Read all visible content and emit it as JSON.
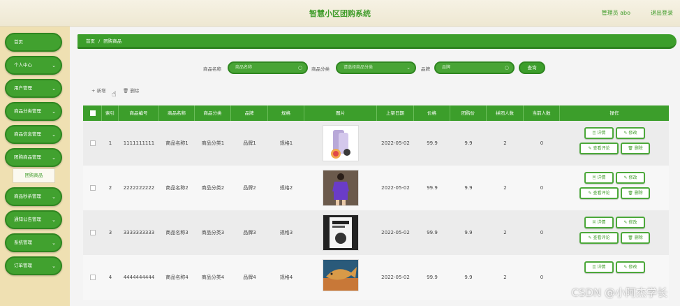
{
  "app": {
    "title": "智慧小区团购系统",
    "user": "管理员 abo",
    "logout": "退出登录"
  },
  "sidebar": {
    "items": [
      {
        "label": "首页",
        "chevron": false
      },
      {
        "label": "个人中心",
        "chevron": true
      },
      {
        "label": "用户管理",
        "chevron": true
      },
      {
        "label": "商品分类管理",
        "chevron": true
      },
      {
        "label": "商品信息管理",
        "chevron": true
      },
      {
        "label": "团购商品管理",
        "chevron": true
      },
      {
        "label": "商品秒杀管理",
        "chevron": true
      },
      {
        "label": "通知公告管理",
        "chevron": true
      },
      {
        "label": "系统管理",
        "chevron": true
      },
      {
        "label": "订单管理",
        "chevron": true
      }
    ],
    "sub_item": "团购商品"
  },
  "breadcrumb": {
    "home": "首页",
    "sep": "/",
    "current": "团购商品"
  },
  "search": {
    "name_label": "商品名称",
    "name_placeholder": "商品名称",
    "category_label": "商品分类",
    "category_placeholder": "请选择商品分类",
    "brand_label": "品牌",
    "brand_placeholder": "品牌",
    "query_button": "查询"
  },
  "toolbar": {
    "add": "+ 新增",
    "delete": "🗑 删除"
  },
  "table": {
    "headers": [
      "索引",
      "商品编号",
      "商品名称",
      "商品分类",
      "品牌",
      "规格",
      "图片",
      "上架日期",
      "价格",
      "团购价",
      "拼团人数",
      "当前人数",
      "操作"
    ],
    "actions": {
      "detail": "🗏 详情",
      "edit": "✎ 修改",
      "review": "✎ 查看评论",
      "delete": "🗑 删除"
    },
    "rows": [
      {
        "index": "1",
        "code": "1111111111",
        "name": "商品名称1",
        "category": "商品分类1",
        "brand": "品牌1",
        "spec": "规格1",
        "image": "phone-image",
        "date": "2022-05-02",
        "price": "99.9",
        "group_price": "9.9",
        "group_size": "2",
        "current": "0"
      },
      {
        "index": "2",
        "code": "2222222222",
        "name": "商品名称2",
        "category": "商品分类2",
        "brand": "品牌2",
        "spec": "规格2",
        "image": "clothing-image",
        "date": "2022-05-02",
        "price": "99.9",
        "group_price": "9.9",
        "group_size": "2",
        "current": "0"
      },
      {
        "index": "3",
        "code": "3333333333",
        "name": "商品名称3",
        "category": "商品分类3",
        "brand": "品牌3",
        "spec": "规格3",
        "image": "book-image",
        "date": "2022-05-02",
        "price": "99.9",
        "group_price": "9.9",
        "group_size": "2",
        "current": "0"
      },
      {
        "index": "4",
        "code": "4444444444",
        "name": "商品名称4",
        "category": "商品分类4",
        "brand": "品牌4",
        "spec": "规格4",
        "image": "fish-image",
        "date": "2022-05-02",
        "price": "99.9",
        "group_price": "9.9",
        "group_size": "2",
        "current": "0"
      }
    ]
  },
  "watermark": "CSDN @小阿杰学长",
  "colors": {
    "primary": "#3c9e2b",
    "sidebar_bg": "#efe0b2"
  }
}
